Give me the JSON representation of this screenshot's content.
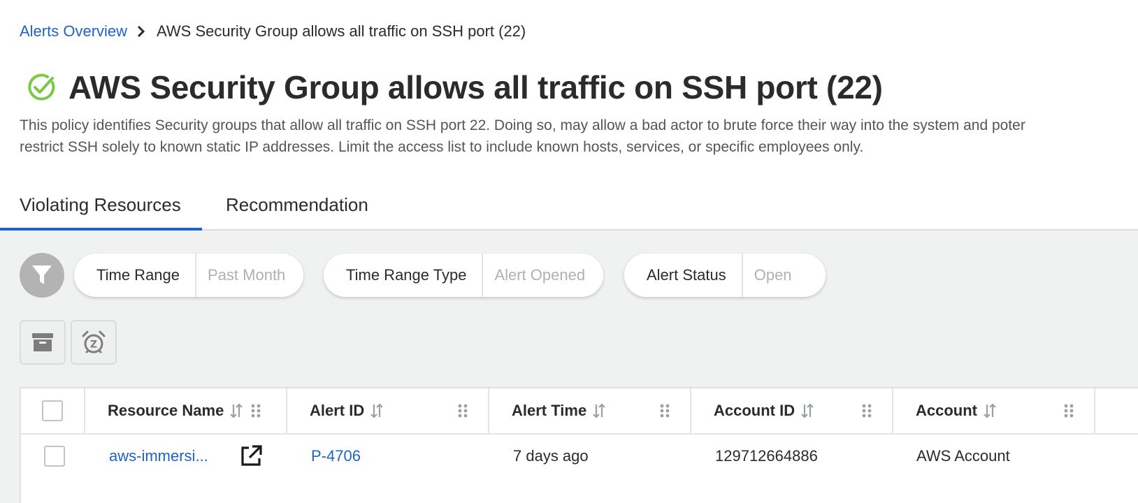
{
  "breadcrumb": {
    "root": "Alerts Overview",
    "current": "AWS Security Group allows all traffic on SSH port (22)"
  },
  "policy": {
    "title": "AWS Security Group allows all traffic on SSH port (22)",
    "status_icon": "check-circle-icon",
    "description_line1": "This policy identifies Security groups that allow all traffic on SSH port 22. Doing so, may allow a bad actor to brute force their way into the system and poter",
    "description_line2": "restrict SSH solely to known static IP addresses. Limit the access list to include known hosts, services, or specific employees only."
  },
  "tabs": [
    {
      "label": "Violating Resources",
      "active": true
    },
    {
      "label": "Recommendation",
      "active": false
    }
  ],
  "filters": [
    {
      "label": "Time Range",
      "value": "Past Month"
    },
    {
      "label": "Time Range Type",
      "value": "Alert Opened"
    },
    {
      "label": "Alert Status",
      "value": "Open"
    }
  ],
  "actions": {
    "archive_icon": "archive-icon",
    "snooze_icon": "snooze-alarm-icon"
  },
  "table": {
    "columns": [
      "Resource Name",
      "Alert ID",
      "Alert Time",
      "Account ID",
      "Account"
    ],
    "rows": [
      {
        "resource_name": "aws-immersi...",
        "alert_id": "P-4706",
        "alert_time": "7 days ago",
        "account_id": "129712664886",
        "account": "AWS Account"
      }
    ]
  },
  "colors": {
    "accent": "#1f63c6",
    "success": "#7ac943",
    "content_bg": "#f0f2f2",
    "filter_button": "#b3b3b3"
  }
}
